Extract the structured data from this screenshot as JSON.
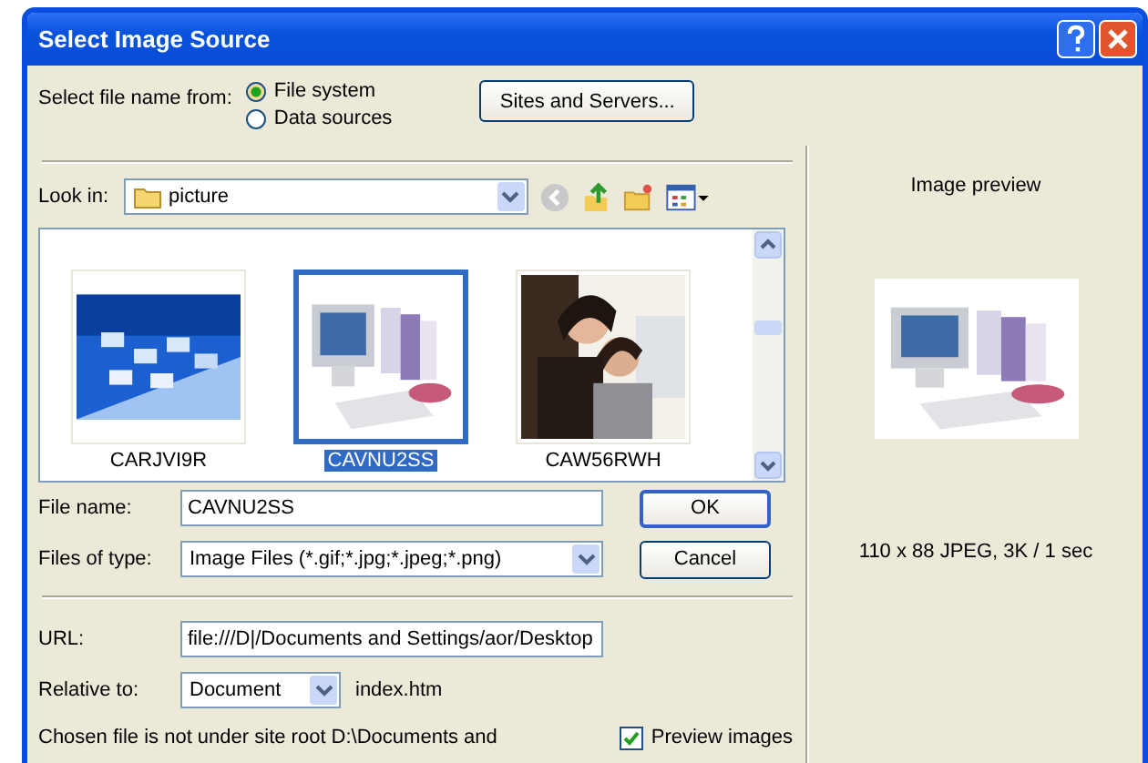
{
  "window": {
    "title": "Select Image Source"
  },
  "source": {
    "label": "Select file name from:",
    "options": [
      {
        "label": "File system",
        "selected": true
      },
      {
        "label": "Data sources",
        "selected": false
      }
    ],
    "button": "Sites and Servers..."
  },
  "look_in": {
    "label": "Look in:",
    "value": "picture"
  },
  "files": [
    {
      "name": "CARJVI9R",
      "selected": false,
      "kind": "picture"
    },
    {
      "name": "CAVNU2SS",
      "selected": true,
      "kind": "picture"
    },
    {
      "name": "CAW56RWH",
      "selected": false,
      "kind": "picture"
    }
  ],
  "file_name": {
    "label": "File name:",
    "value": "CAVNU2SS"
  },
  "file_type": {
    "label": "Files of type:",
    "value": "Image Files (*.gif;*.jpg;*.jpeg;*.png)"
  },
  "buttons": [
    "OK",
    "Cancel"
  ],
  "url": {
    "label": "URL:",
    "value": "file:///D|/Documents and Settings/aor/Desktop"
  },
  "relative_to": {
    "label": "Relative to:",
    "value": "Document",
    "file": "index.htm"
  },
  "note": "Chosen file is not under site root D:\\Documents and",
  "preview_images": {
    "label": "Preview images",
    "checked": true
  },
  "preview": {
    "title": "Image preview",
    "info": "110 x 88 JPEG, 3K / 1 sec"
  }
}
